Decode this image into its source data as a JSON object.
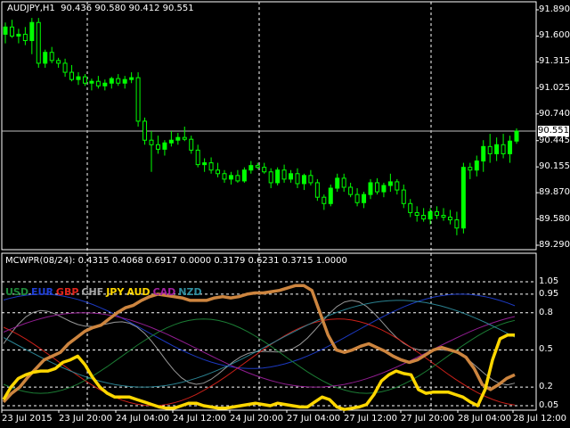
{
  "main_chart": {
    "header": "AUDJPY,H1  90.436 90.580 90.412 90.551",
    "current_price": "90.551",
    "price_ticks": [
      {
        "label": "91.890",
        "v": 91.89
      },
      {
        "label": "91.600",
        "v": 91.6
      },
      {
        "label": "91.315",
        "v": 91.315
      },
      {
        "label": "91.025",
        "v": 91.025
      },
      {
        "label": "90.740",
        "v": 90.74
      },
      {
        "label": "90.445",
        "v": 90.445
      },
      {
        "label": "90.155",
        "v": 90.155
      },
      {
        "label": "89.870",
        "v": 89.87
      },
      {
        "label": "89.580",
        "v": 89.58
      },
      {
        "label": "89.290",
        "v": 89.29
      }
    ]
  },
  "indicator": {
    "header": "MCWPR(08/24): 0.4315 0.4068 0.6917 0.0000 0.3179 0.6231 0.3715 1.0000",
    "legend": [
      {
        "name": "USD",
        "color": "#1E8A3A"
      },
      {
        "name": "EUR",
        "color": "#1F3FD6"
      },
      {
        "name": "GBP",
        "color": "#E0241C"
      },
      {
        "name": "CHF",
        "color": "#A9A9A9"
      },
      {
        "name": "JPY",
        "color": "#FFD700"
      },
      {
        "name": "AUD",
        "color": "#FFD700"
      },
      {
        "name": "CAD",
        "color": "#A020A0"
      },
      {
        "name": "NZD",
        "color": "#2F8FA0"
      }
    ],
    "levels": [
      {
        "label": "1.05",
        "v": 1.05
      },
      {
        "label": "0.95",
        "v": 0.95
      },
      {
        "label": "0.8",
        "v": 0.8
      },
      {
        "label": "0.5",
        "v": 0.5
      },
      {
        "label": "0.2",
        "v": 0.2
      },
      {
        "label": "0.05",
        "v": 0.05
      }
    ]
  },
  "time_axis": [
    "23 Jul 2015",
    "23 Jul 20:00",
    "24 Jul 04:00",
    "24 Jul 12:00",
    "24 Jul 20:00",
    "27 Jul 04:00",
    "27 Jul 12:00",
    "27 Jul 20:00",
    "28 Jul 04:00",
    "28 Jul 12:00"
  ],
  "colors": {
    "bull": "#00FF00",
    "bear": "#000000",
    "candle_outline": "#00FF00",
    "grid": "#FFFFFF",
    "aud_line": "#FFD700",
    "jpy_line": "#CD853F"
  },
  "chart_data": {
    "type": "candlestick",
    "symbol": "AUDJPY",
    "timeframe": "H1",
    "ylim": [
      89.29,
      91.89
    ],
    "ohlc": [
      [
        91.62,
        91.75,
        91.52,
        91.7
      ],
      [
        91.7,
        91.78,
        91.58,
        91.6
      ],
      [
        91.6,
        91.68,
        91.52,
        91.62
      ],
      [
        91.62,
        91.7,
        91.5,
        91.55
      ],
      [
        91.55,
        91.8,
        91.4,
        91.75
      ],
      [
        91.75,
        91.8,
        91.25,
        91.3
      ],
      [
        91.3,
        91.45,
        91.25,
        91.42
      ],
      [
        91.42,
        91.48,
        91.3,
        91.33
      ],
      [
        91.33,
        91.36,
        91.25,
        91.3
      ],
      [
        91.3,
        91.35,
        91.15,
        91.2
      ],
      [
        91.2,
        91.28,
        91.1,
        91.12
      ],
      [
        91.12,
        91.2,
        91.06,
        91.15
      ],
      [
        91.15,
        91.18,
        91.05,
        91.08
      ],
      [
        91.08,
        91.13,
        91.0,
        91.1
      ],
      [
        91.1,
        91.16,
        91.02,
        91.05
      ],
      [
        91.05,
        91.12,
        91.0,
        91.08
      ],
      [
        91.08,
        91.15,
        91.02,
        91.13
      ],
      [
        91.13,
        91.18,
        91.05,
        91.08
      ],
      [
        91.08,
        91.16,
        91.02,
        91.12
      ],
      [
        91.12,
        91.2,
        91.08,
        91.14
      ],
      [
        91.14,
        91.2,
        90.6,
        90.66
      ],
      [
        90.66,
        90.7,
        90.4,
        90.45
      ],
      [
        90.45,
        90.55,
        90.1,
        90.4
      ],
      [
        90.4,
        90.5,
        90.3,
        90.35
      ],
      [
        90.35,
        90.45,
        90.28,
        90.42
      ],
      [
        90.42,
        90.55,
        90.38,
        90.45
      ],
      [
        90.45,
        90.53,
        90.4,
        90.48
      ],
      [
        90.48,
        90.6,
        90.44,
        90.46
      ],
      [
        90.46,
        90.5,
        90.3,
        90.34
      ],
      [
        90.34,
        90.4,
        90.15,
        90.18
      ],
      [
        90.18,
        90.25,
        90.1,
        90.2
      ],
      [
        90.2,
        90.26,
        90.08,
        90.12
      ],
      [
        90.12,
        90.2,
        90.04,
        90.08
      ],
      [
        90.08,
        90.12,
        89.98,
        90.02
      ],
      [
        90.02,
        90.1,
        89.96,
        90.06
      ],
      [
        90.06,
        90.12,
        89.98,
        90.0
      ],
      [
        90.0,
        90.15,
        89.98,
        90.12
      ],
      [
        90.12,
        90.22,
        90.08,
        90.17
      ],
      [
        90.17,
        90.2,
        90.13,
        90.15
      ],
      [
        90.15,
        90.2,
        90.08,
        90.1
      ],
      [
        90.1,
        90.14,
        89.92,
        89.98
      ],
      [
        89.98,
        90.15,
        89.95,
        90.12
      ],
      [
        90.12,
        90.18,
        89.98,
        90.02
      ],
      [
        90.02,
        90.12,
        89.98,
        90.08
      ],
      [
        90.08,
        90.14,
        89.92,
        89.97
      ],
      [
        89.97,
        90.08,
        89.9,
        90.06
      ],
      [
        90.06,
        90.12,
        89.95,
        89.98
      ],
      [
        89.98,
        90.02,
        89.78,
        89.82
      ],
      [
        89.82,
        89.85,
        89.68,
        89.75
      ],
      [
        89.75,
        89.96,
        89.72,
        89.92
      ],
      [
        89.92,
        90.08,
        89.88,
        90.03
      ],
      [
        90.03,
        90.08,
        89.88,
        89.93
      ],
      [
        89.93,
        89.98,
        89.82,
        89.85
      ],
      [
        89.85,
        89.92,
        89.72,
        89.76
      ],
      [
        89.76,
        89.88,
        89.7,
        89.85
      ],
      [
        89.85,
        90.02,
        89.8,
        89.98
      ],
      [
        89.98,
        90.03,
        89.85,
        89.88
      ],
      [
        89.88,
        89.98,
        89.82,
        89.95
      ],
      [
        89.95,
        90.08,
        89.88,
        89.99
      ],
      [
        89.99,
        90.02,
        89.85,
        89.9
      ],
      [
        89.9,
        89.96,
        89.7,
        89.75
      ],
      [
        89.75,
        89.8,
        89.6,
        89.65
      ],
      [
        89.65,
        89.72,
        89.55,
        89.62
      ],
      [
        89.62,
        89.7,
        89.55,
        89.58
      ],
      [
        89.58,
        89.7,
        89.52,
        89.66
      ],
      [
        89.66,
        89.72,
        89.58,
        89.62
      ],
      [
        89.62,
        89.7,
        89.56,
        89.6
      ],
      [
        89.6,
        89.68,
        89.52,
        89.57
      ],
      [
        89.57,
        89.66,
        89.4,
        89.48
      ],
      [
        89.48,
        90.2,
        89.42,
        90.15
      ],
      [
        90.15,
        90.2,
        90.02,
        90.12
      ],
      [
        90.12,
        90.28,
        90.05,
        90.22
      ],
      [
        90.22,
        90.45,
        90.1,
        90.38
      ],
      [
        90.38,
        90.52,
        90.2,
        90.3
      ],
      [
        90.3,
        90.48,
        90.22,
        90.4
      ],
      [
        90.4,
        90.52,
        90.25,
        90.3
      ],
      [
        90.3,
        90.5,
        90.2,
        90.44
      ],
      [
        90.44,
        90.58,
        90.41,
        90.55
      ]
    ],
    "indicator_series": {
      "AUD": [
        0.1,
        0.2,
        0.27,
        0.3,
        0.32,
        0.33,
        0.33,
        0.35,
        0.4,
        0.42,
        0.45,
        0.38,
        0.28,
        0.2,
        0.15,
        0.12,
        0.12,
        0.12,
        0.1,
        0.08,
        0.06,
        0.04,
        0.03,
        0.03,
        0.05,
        0.07,
        0.07,
        0.05,
        0.04,
        0.03,
        0.03,
        0.04,
        0.05,
        0.06,
        0.07,
        0.06,
        0.05,
        0.07,
        0.06,
        0.05,
        0.04,
        0.04,
        0.08,
        0.12,
        0.1,
        0.04,
        0.02,
        0.03,
        0.04,
        0.06,
        0.14,
        0.25,
        0.3,
        0.33,
        0.31,
        0.3,
        0.18,
        0.15,
        0.16,
        0.16,
        0.16,
        0.14,
        0.12,
        0.08,
        0.05,
        0.18,
        0.42,
        0.59,
        0.62,
        0.62
      ],
      "JPY": [
        0.08,
        0.15,
        0.2,
        0.28,
        0.35,
        0.42,
        0.45,
        0.48,
        0.55,
        0.6,
        0.65,
        0.68,
        0.7,
        0.75,
        0.8,
        0.84,
        0.86,
        0.9,
        0.93,
        0.95,
        0.94,
        0.93,
        0.92,
        0.9,
        0.9,
        0.9,
        0.92,
        0.93,
        0.92,
        0.93,
        0.95,
        0.96,
        0.96,
        0.97,
        0.98,
        1.0,
        1.02,
        1.02,
        0.98,
        0.8,
        0.62,
        0.5,
        0.48,
        0.5,
        0.53,
        0.55,
        0.52,
        0.49,
        0.45,
        0.42,
        0.4,
        0.42,
        0.46,
        0.5,
        0.52,
        0.5,
        0.48,
        0.44,
        0.35,
        0.22,
        0.18,
        0.22,
        0.27,
        0.3
      ]
    }
  }
}
